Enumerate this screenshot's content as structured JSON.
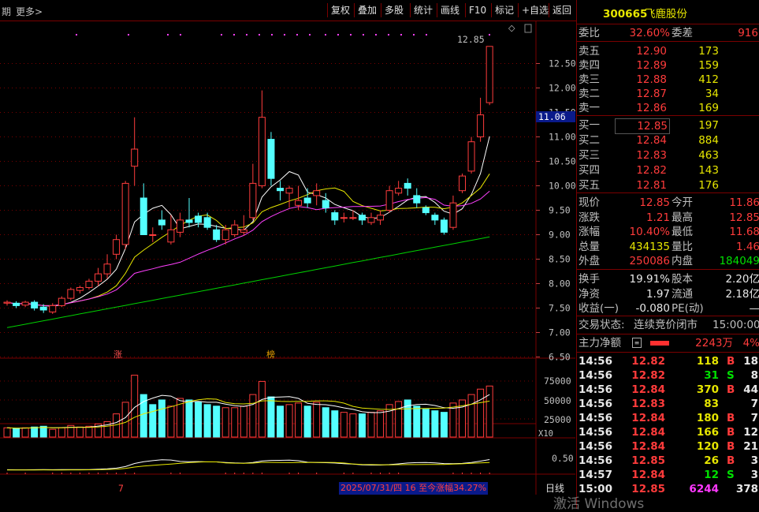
{
  "toolbar": {
    "left_label": "期",
    "more_label": "更多>",
    "buttons": [
      "复权",
      "叠加",
      "多股",
      "统计",
      "画线",
      "F10",
      "标记",
      "+自选",
      "返回"
    ]
  },
  "chart": {
    "price_axis": [
      "12.50",
      "12.00",
      "11.50",
      "11.00",
      "10.50",
      "10.00",
      "9.50",
      "9.00",
      "8.50",
      "8.00",
      "7.50",
      "7.00",
      "6.50"
    ],
    "current_price_tag": "11.06",
    "high_label": "12.85",
    "limit_up_mark": "涨",
    "list_mark": "榜",
    "volume_axis": [
      "75000",
      "50000",
      "25000"
    ],
    "volume_unit": "X10",
    "indicator_axis": [
      "0.50"
    ],
    "bottom_period": "日线",
    "bottom_x_label": "7",
    "range_note": "2025/07/31/四 16 至今涨幅34.27%"
  },
  "chart_data": {
    "type": "candlestick",
    "candles": [
      [
        7.6,
        7.62,
        7.55,
        7.66
      ],
      [
        7.6,
        7.55,
        7.5,
        7.64
      ],
      [
        7.56,
        7.62,
        7.52,
        7.65
      ],
      [
        7.62,
        7.5,
        7.45,
        7.66
      ],
      [
        7.52,
        7.46,
        7.4,
        7.58
      ],
      [
        7.42,
        7.55,
        7.38,
        7.6
      ],
      [
        7.55,
        7.7,
        7.52,
        7.74
      ],
      [
        7.7,
        7.88,
        7.66,
        7.92
      ],
      [
        7.86,
        7.92,
        7.8,
        7.96
      ],
      [
        7.92,
        8.05,
        7.88,
        8.1
      ],
      [
        8.05,
        8.2,
        7.95,
        8.32
      ],
      [
        8.2,
        8.4,
        8.1,
        8.6
      ],
      [
        8.6,
        8.9,
        8.5,
        9.0
      ],
      [
        8.8,
        10.05,
        8.7,
        10.1
      ],
      [
        10.4,
        10.75,
        10.0,
        11.4
      ],
      [
        9.75,
        9.0,
        9.5,
        10.05
      ],
      [
        9.0,
        9.0,
        8.85,
        9.15
      ],
      [
        9.3,
        9.2,
        9.1,
        9.5
      ],
      [
        8.85,
        9.1,
        8.8,
        9.4
      ],
      [
        9.05,
        9.3,
        8.95,
        9.45
      ],
      [
        9.3,
        9.25,
        9.15,
        9.75
      ],
      [
        9.38,
        9.25,
        9.15,
        9.45
      ],
      [
        9.35,
        9.15,
        9.1,
        9.45
      ],
      [
        9.1,
        8.9,
        8.85,
        9.2
      ],
      [
        8.9,
        9.1,
        8.8,
        9.2
      ],
      [
        9.0,
        9.2,
        8.95,
        9.3
      ],
      [
        9.05,
        9.1,
        8.98,
        9.4
      ],
      [
        9.35,
        10.05,
        9.3,
        10.45
      ],
      [
        10.0,
        11.4,
        9.95,
        11.95
      ],
      [
        10.95,
        10.15,
        10.0,
        11.1
      ],
      [
        9.95,
        9.9,
        9.7,
        10.1
      ],
      [
        9.85,
        9.95,
        9.55,
        10.0
      ],
      [
        9.6,
        9.7,
        9.5,
        10.0
      ],
      [
        9.75,
        9.65,
        9.55,
        9.95
      ],
      [
        9.8,
        9.9,
        9.6,
        10.05
      ],
      [
        9.7,
        9.55,
        9.45,
        9.85
      ],
      [
        9.45,
        9.3,
        9.2,
        9.5
      ],
      [
        9.35,
        9.35,
        9.25,
        9.45
      ],
      [
        9.35,
        9.35,
        9.3,
        9.5
      ],
      [
        9.4,
        9.3,
        9.2,
        9.45
      ],
      [
        9.25,
        9.35,
        9.2,
        9.45
      ],
      [
        9.3,
        9.4,
        9.2,
        9.5
      ],
      [
        9.5,
        9.9,
        9.45,
        10.0
      ],
      [
        9.85,
        9.95,
        9.8,
        10.1
      ],
      [
        10.05,
        9.95,
        9.8,
        10.15
      ],
      [
        9.8,
        9.65,
        9.55,
        9.95
      ],
      [
        9.55,
        9.45,
        9.4,
        9.6
      ],
      [
        9.4,
        9.3,
        9.2,
        9.45
      ],
      [
        9.3,
        9.05,
        9.0,
        9.35
      ],
      [
        9.15,
        9.65,
        9.1,
        9.8
      ],
      [
        9.9,
        10.2,
        9.85,
        10.25
      ],
      [
        10.3,
        10.9,
        10.25,
        11.0
      ],
      [
        11.0,
        11.45,
        10.9,
        11.8
      ],
      [
        11.7,
        12.85,
        11.65,
        12.85
      ]
    ],
    "volumes": [
      12,
      11,
      12,
      13,
      14,
      10,
      12,
      15,
      13,
      14,
      17,
      20,
      30,
      45,
      80,
      55,
      42,
      48,
      40,
      50,
      48,
      45,
      42,
      40,
      38,
      38,
      40,
      55,
      72,
      52,
      40,
      42,
      44,
      40,
      45,
      38,
      34,
      32,
      30,
      30,
      32,
      34,
      42,
      46,
      48,
      40,
      36,
      34,
      32,
      44,
      48,
      55,
      62,
      66
    ],
    "vol_up": [
      1,
      0,
      1,
      0,
      0,
      1,
      1,
      1,
      1,
      1,
      1,
      1,
      1,
      1,
      1,
      0,
      0,
      0,
      1,
      1,
      0,
      0,
      0,
      0,
      1,
      1,
      1,
      1,
      1,
      0,
      0,
      1,
      1,
      0,
      1,
      0,
      0,
      1,
      1,
      0,
      1,
      1,
      1,
      1,
      0,
      0,
      0,
      0,
      0,
      1,
      1,
      1,
      1,
      1
    ],
    "ma_series": [
      {
        "color": "#ffffff"
      },
      {
        "color": "#e6e600"
      },
      {
        "color": "#ff40ff"
      },
      {
        "color": "#00d000"
      }
    ]
  },
  "panel": {
    "stock_code": "300665",
    "stock_name": "飞鹿股份",
    "weibi_label": "委比",
    "weibi_value": "32.60%",
    "weicha_label": "委差",
    "weicha_value": "916",
    "asks": [
      {
        "label": "卖五",
        "price": "12.90",
        "vol": "173"
      },
      {
        "label": "卖四",
        "price": "12.89",
        "vol": "159"
      },
      {
        "label": "卖三",
        "price": "12.88",
        "vol": "412"
      },
      {
        "label": "卖二",
        "price": "12.87",
        "vol": "34"
      },
      {
        "label": "卖一",
        "price": "12.86",
        "vol": "169"
      }
    ],
    "bids": [
      {
        "label": "买一",
        "price": "12.85",
        "vol": "197"
      },
      {
        "label": "买二",
        "price": "12.84",
        "vol": "884"
      },
      {
        "label": "买三",
        "price": "12.83",
        "vol": "463"
      },
      {
        "label": "买四",
        "price": "12.82",
        "vol": "143"
      },
      {
        "label": "买五",
        "price": "12.81",
        "vol": "176"
      }
    ],
    "stats": [
      {
        "l1": "现价",
        "v1": "12.85",
        "c1": "red",
        "l2": "今开",
        "v2": "11.86",
        "c2": "red"
      },
      {
        "l1": "涨跌",
        "v1": "1.21",
        "c1": "red",
        "l2": "最高",
        "v2": "12.85",
        "c2": "red"
      },
      {
        "l1": "涨幅",
        "v1": "10.40%",
        "c1": "red",
        "l2": "最低",
        "v2": "11.68",
        "c2": "red"
      },
      {
        "l1": "总量",
        "v1": "434135",
        "c1": "yellow",
        "l2": "量比",
        "v2": "1.46",
        "c2": "red"
      },
      {
        "l1": "外盘",
        "v1": "250086",
        "c1": "red",
        "l2": "内盘",
        "v2": "184049",
        "c2": "green"
      }
    ],
    "stats2": [
      {
        "l1": "换手",
        "v1": "19.91%",
        "l2": "股本",
        "v2": "2.20亿"
      },
      {
        "l1": "净资",
        "v1": "1.97",
        "l2": "流通",
        "v2": "2.18亿"
      },
      {
        "l1": "收益(一)",
        "v1": "-0.080",
        "l2": "PE(动)",
        "v2": "—"
      }
    ],
    "trade_state_label": "交易状态:",
    "trade_state_value": "连续竞价闭市",
    "trade_state_time": "15:00:00",
    "main_flow_label": "主力净额",
    "main_flow_value": "2243万",
    "main_flow_pct": "4%",
    "ticks": [
      {
        "t": "14:56",
        "p": "12.82",
        "v": "118",
        "s": "B",
        "n": "18"
      },
      {
        "t": "14:56",
        "p": "12.82",
        "v": "31",
        "s": "S",
        "n": "8"
      },
      {
        "t": "14:56",
        "p": "12.84",
        "v": "370",
        "s": "B",
        "n": "44"
      },
      {
        "t": "14:56",
        "p": "12.83",
        "v": "83",
        "s": "",
        "n": "7"
      },
      {
        "t": "14:56",
        "p": "12.84",
        "v": "180",
        "s": "B",
        "n": "7"
      },
      {
        "t": "14:56",
        "p": "12.84",
        "v": "166",
        "s": "B",
        "n": "12"
      },
      {
        "t": "14:56",
        "p": "12.84",
        "v": "120",
        "s": "B",
        "n": "21"
      },
      {
        "t": "14:56",
        "p": "12.85",
        "v": "26",
        "s": "B",
        "n": "3"
      },
      {
        "t": "14:57",
        "p": "12.84",
        "v": "12",
        "s": "S",
        "n": "3"
      },
      {
        "t": "15:00",
        "p": "12.85",
        "v": "6244",
        "s": "",
        "n": "378"
      }
    ]
  },
  "watermark": "激活 Windows"
}
